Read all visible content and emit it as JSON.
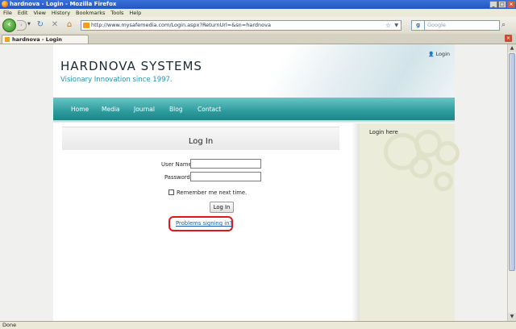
{
  "window": {
    "title": "hardnova - Login - Mozilla Firefox",
    "controls": [
      "minimize-button",
      "maximize-button",
      "close-button"
    ]
  },
  "menu": {
    "items": [
      "File",
      "Edit",
      "View",
      "History",
      "Bookmarks",
      "Tools",
      "Help"
    ]
  },
  "toolbar": {
    "url": "http://www.mysafemedia.com/Login.aspx?ReturnUrl=&sn=hardnova",
    "search_placeholder": "Google",
    "search_engine_icon": "google-icon"
  },
  "tabs": [
    {
      "label": "hardnova - Login"
    }
  ],
  "status": {
    "text": "Done"
  },
  "site": {
    "brand": "HARDNOVA SYSTEMS",
    "tagline": "Visionary Innovation since 1997.",
    "login_link": "Login",
    "nav": [
      "Home",
      "Media",
      "Journal",
      "Blog",
      "Contact"
    ],
    "accent_color": "#2d9c9e"
  },
  "login": {
    "title": "Log In",
    "username_label": "User Name:",
    "username_value": "",
    "password_label": "Password:",
    "password_value": "",
    "remember_label": "Remember me next time.",
    "remember_checked": false,
    "submit_label": "Log In",
    "problems_link": "Problems signing in?",
    "highlight_color": "#e01818"
  },
  "sidebar": {
    "title": "Login here"
  }
}
